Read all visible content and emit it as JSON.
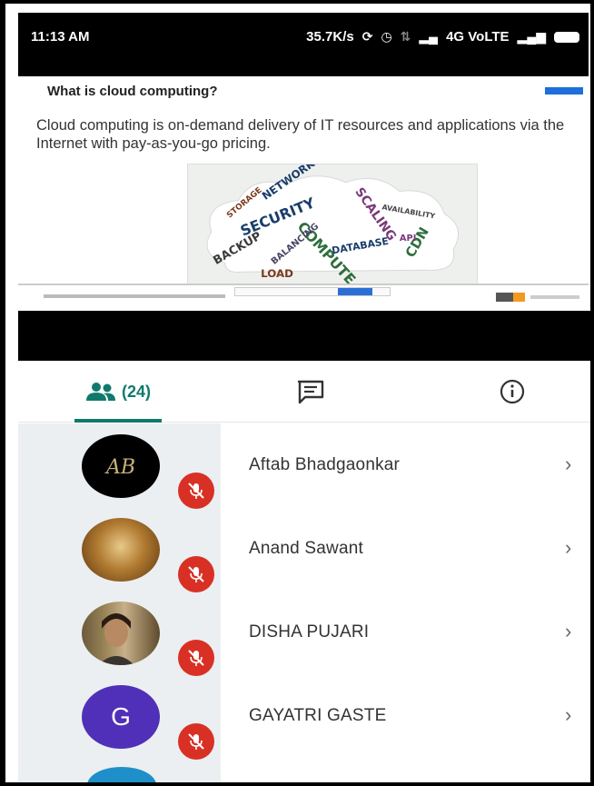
{
  "statusbar": {
    "time": "11:13 AM",
    "speed": "35.7K/s",
    "network": "4G VoLTE"
  },
  "slide": {
    "title": "What is cloud computing?",
    "body": "Cloud computing is on-demand delivery of IT resources and applications via the Internet with pay-as-you-go pricing.",
    "wordcloud_words": [
      "SECURITY",
      "COMPUTE",
      "SCALING",
      "DATABASE",
      "BACKUP",
      "LOAD",
      "BALANCING",
      "CDN",
      "STORAGE",
      "NETWORK",
      "AVAILABILITY",
      "API"
    ]
  },
  "tabs": {
    "people_count": "(24)"
  },
  "participants": [
    {
      "name": "Aftab Bhadgaonkar",
      "avatar": "AB"
    },
    {
      "name": "Anand Sawant"
    },
    {
      "name": "DISHA PUJARI"
    },
    {
      "name": "GAYATRI GASTE",
      "initial": "G"
    }
  ],
  "icons": {
    "chevron": "›",
    "people": "people-icon",
    "chat": "chat-icon",
    "info": "info-icon",
    "mic_off": "mic-off-icon"
  },
  "colors": {
    "accent": "#0f7a6c",
    "mic_badge": "#d93025",
    "avatar_g": "#5030b8"
  }
}
